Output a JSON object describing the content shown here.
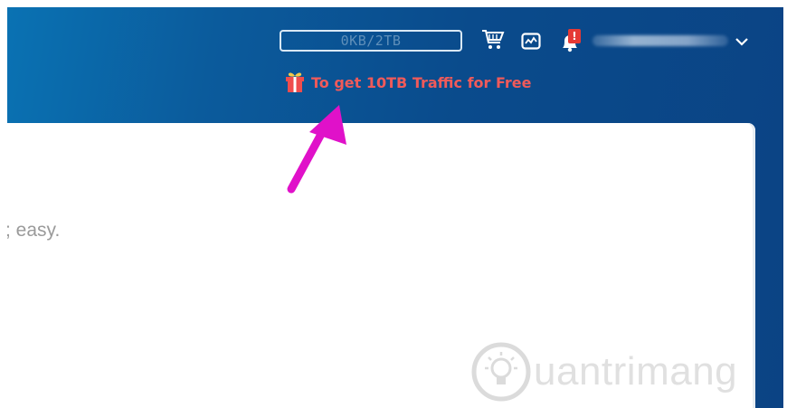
{
  "header": {
    "traffic_usage": "0KB/2TB",
    "notification_badge": "!",
    "promo_text": "To get 10TB Traffic for Free"
  },
  "icons": {
    "cart": "cart-icon",
    "monitor": "monitor-icon",
    "bell": "bell-icon",
    "chevron": "chevron-down-icon",
    "gift": "gift-icon"
  },
  "main": {
    "partial_text": "; easy."
  },
  "annotation": {
    "arrow_color": "#e011c9"
  },
  "watermark": {
    "text": "uantrimang"
  },
  "colors": {
    "header_bg": "#0b4a8c",
    "promo_text": "#f05a5a",
    "badge": "#e53935"
  }
}
